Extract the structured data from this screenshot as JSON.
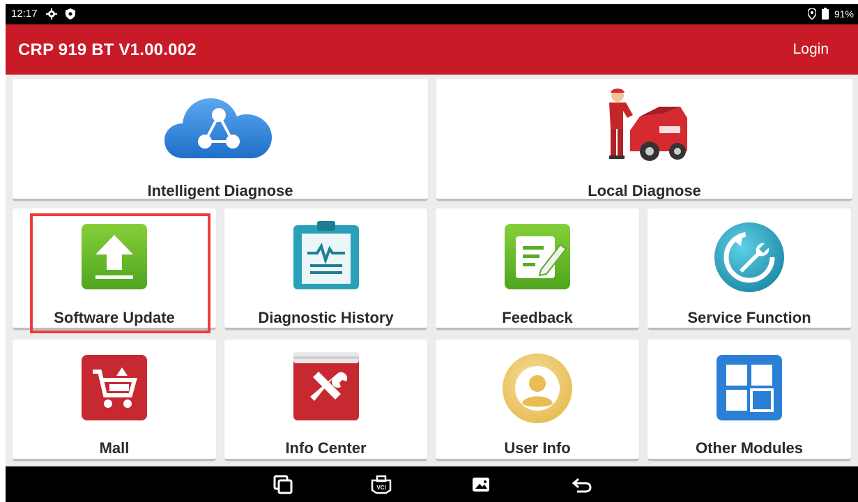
{
  "status_bar": {
    "time": "12:17",
    "icons_left": [
      "gear-icon",
      "shield-icon"
    ],
    "icons_right": [
      "location-icon",
      "battery-icon"
    ],
    "battery": "91%"
  },
  "app_bar": {
    "title": "CRP 919 BT V1.00.002",
    "login_label": "Login",
    "background_color": "#c81b27"
  },
  "tiles": [
    {
      "label": "Intelligent Diagnose",
      "icon": "cloud-share-icon"
    },
    {
      "label": "Local Diagnose",
      "icon": "mechanic-car-icon"
    },
    {
      "label": "Software Update",
      "icon": "upload-icon",
      "highlighted": true
    },
    {
      "label": "Diagnostic History",
      "icon": "clipboard-waveform-icon"
    },
    {
      "label": "Feedback",
      "icon": "edit-note-icon"
    },
    {
      "label": "Service Function",
      "icon": "wrench-refresh-icon"
    },
    {
      "label": "Mall",
      "icon": "shopping-cart-icon"
    },
    {
      "label": "Info Center",
      "icon": "tools-book-icon"
    },
    {
      "label": "User Info",
      "icon": "user-avatar-icon"
    },
    {
      "label": "Other Modules",
      "icon": "grid-modules-icon"
    }
  ],
  "nav_bar": {
    "buttons": [
      "recent-apps-icon",
      "vci-icon",
      "screenshot-icon",
      "back-icon"
    ],
    "vci_text": "VCI"
  },
  "colors": {
    "highlight_border": "#ee3b3b",
    "green": "#6cbf2c",
    "teal": "#2aa0b8",
    "red": "#c62a30",
    "blue": "#2b7fd4"
  }
}
